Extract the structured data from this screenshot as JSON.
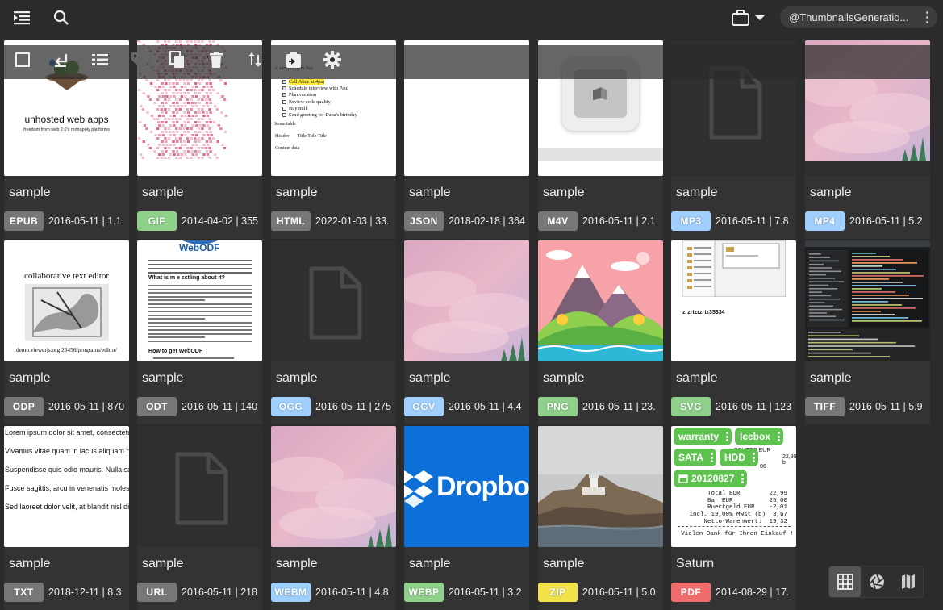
{
  "topbar": {
    "account_label": "@ThumbnailsGeneratio...",
    "icons": [
      "menu-collapse-icon",
      "search-icon",
      "briefcase-icon",
      "chevron-down-icon",
      "more-vert-icon"
    ]
  },
  "actionbar": {
    "icons": [
      "select-all-checkbox-icon",
      "return-icon",
      "list-icon",
      "tag-icon",
      "copy-icon",
      "delete-icon",
      "sort-icon",
      "export-icon",
      "settings-icon"
    ]
  },
  "colors": {
    "gray": "#777777",
    "light_blue": "#9fd0ff",
    "green": "#8fd18a",
    "yellow": "#f2e34b",
    "red": "#f06b6b",
    "tag_green": "#5ec24f"
  },
  "items": [
    {
      "title": "sample",
      "ext": "EPUB",
      "meta": "2016-05-11 | 1.1",
      "badge_color": "#777777",
      "thumb": "epub"
    },
    {
      "title": "sample",
      "ext": "GIF",
      "meta": "2014-04-02 | 355",
      "badge_color": "#8fd18a",
      "thumb": "gif"
    },
    {
      "title": "sample",
      "ext": "HTML",
      "meta": "2022-01-03 | 33.",
      "badge_color": "#777777",
      "thumb": "html"
    },
    {
      "title": "sample",
      "ext": "JSON",
      "meta": "2018-02-18 | 364",
      "badge_color": "#777777",
      "thumb": "json"
    },
    {
      "title": "sample",
      "ext": "M4V",
      "meta": "2016-05-11 | 2.1",
      "badge_color": "#777777",
      "thumb": "m4v"
    },
    {
      "title": "sample",
      "ext": "MP3",
      "meta": "2016-05-11 | 7.8",
      "badge_color": "#9fd0ff",
      "thumb": "file"
    },
    {
      "title": "sample",
      "ext": "MP4",
      "meta": "2016-05-11 | 5.2",
      "badge_color": "#9fd0ff",
      "thumb": "clouds"
    },
    {
      "title": "sample",
      "ext": "ODP",
      "meta": "2016-05-11 | 870",
      "badge_color": "#777777",
      "thumb": "odp"
    },
    {
      "title": "sample",
      "ext": "ODT",
      "meta": "2016-05-11 | 140",
      "badge_color": "#777777",
      "thumb": "odt"
    },
    {
      "title": "sample",
      "ext": "OGG",
      "meta": "2016-05-11 | 275",
      "badge_color": "#9fd0ff",
      "thumb": "file"
    },
    {
      "title": "sample",
      "ext": "OGV",
      "meta": "2016-05-11 | 4.4",
      "badge_color": "#9fd0ff",
      "thumb": "clouds"
    },
    {
      "title": "sample",
      "ext": "PNG",
      "meta": "2016-05-11 | 23.",
      "badge_color": "#8fd18a",
      "thumb": "png"
    },
    {
      "title": "sample",
      "ext": "SVG",
      "meta": "2016-05-11 | 123",
      "badge_color": "#8fd18a",
      "thumb": "svg"
    },
    {
      "title": "sample",
      "ext": "TIFF",
      "meta": "2016-05-11 | 5.9",
      "badge_color": "#777777",
      "thumb": "tiff"
    },
    {
      "title": "sample",
      "ext": "TXT",
      "meta": "2018-12-11 | 8.3",
      "badge_color": "#777777",
      "thumb": "txt"
    },
    {
      "title": "sample",
      "ext": "URL",
      "meta": "2016-05-11 | 218",
      "badge_color": "#777777",
      "thumb": "file"
    },
    {
      "title": "sample",
      "ext": "WEBM",
      "meta": "2016-05-11 | 4.8",
      "badge_color": "#9fd0ff",
      "thumb": "clouds"
    },
    {
      "title": "sample",
      "ext": "WEBP",
      "meta": "2016-05-11 | 3.2",
      "badge_color": "#8fd18a",
      "thumb": "dropbox"
    },
    {
      "title": "sample",
      "ext": "ZIP",
      "meta": "2016-05-11 | 5.0",
      "badge_color": "#f2e34b",
      "thumb": "zip"
    },
    {
      "title": "Saturn",
      "ext": "PDF",
      "meta": "2014-08-29 | 17.",
      "badge_color": "#f06b6b",
      "thumb": "pdf"
    }
  ],
  "thumb_text": {
    "epub_title": "unhosted web apps",
    "epub_sub": "freedom from web 2.0's monopoly platforms",
    "html_lines": [
      "A sample todo list:",
      "Call Alice at 4pm",
      "Schedule interview with Paul",
      "Plan vacation",
      "Review code quality",
      "Buy milk",
      "Send greeting for Dana's birthday",
      "Some table",
      "Header       Title Title Title",
      "Content data"
    ],
    "odp_title": "collaborative text editor",
    "odp_url": "demo.viewerjs.org:23456/programs/editor/",
    "odt_brand": "WebODF",
    "odt_heading": "What is m e sstling about it?",
    "odt_heading2": "How to get WebODF",
    "dropbox_word": "Dropbox",
    "svg_caption": "zrzrtzrzrtz35334",
    "txt_lines": [
      "Lorem ipsum dolor sit amet, consectetur",
      "Vivamus vitae quam in lacus aliquam rutr",
      "Suspendisse quis odio mauris. Nulla sag",
      "Fusce sagittis, arcu in venenatis molestie",
      "Sed laoreet dolor velit, at blandit nisl dign"
    ],
    "pdf_lines": [
      "Total EUR        22,99",
      "Bar EUR          25,00",
      "Rueckgeld EUR    -2,01",
      "incl. 19,00% Mwst (b)  3,67",
      "Netto-Warenwert:  19,32",
      "Vielen Dank für Ihren Einkauf !"
    ],
    "pdf_tags": [
      "warranty",
      "Icebox",
      "SATA",
      "HDD",
      "20120827"
    ]
  },
  "views": {
    "icons": [
      "grid-view-icon",
      "aperture-view-icon",
      "map-view-icon"
    ]
  }
}
